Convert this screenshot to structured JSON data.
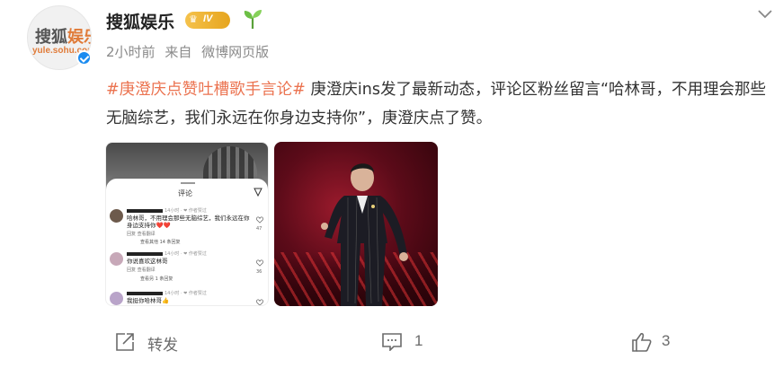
{
  "author": {
    "avatar_logo_cn": "搜狐",
    "avatar_logo_cn_accent": "娱乐",
    "avatar_logo_url": "yule.sohu.com",
    "name": "搜狐娱乐",
    "vip_level": "IV"
  },
  "meta": {
    "time": "2小时前",
    "source_prefix": "来自",
    "source": "微博网页版"
  },
  "post": {
    "hashtag": "#庚澄庆点赞吐槽歌手言论#",
    "text": " 庚澄庆ins发了最新动态，评论区粉丝留言“哈林哥，不用理会那些无脑综艺，我们永远在你身边支持你”，庚澄庆点了赞。"
  },
  "screenshot_thumb": {
    "sheet_title": "评论",
    "comments": [
      {
        "info": "14小时 · ❤ 作者赞过",
        "body": "哈林哥，不用理会那些无脑综艺，我们永远在你身边支持你❤️❤️",
        "actions": "回复    查看翻译",
        "sub": "查看其他 14 条回复",
        "likes": "47"
      },
      {
        "info": "14小时 · ❤ 作者赞过",
        "body": "你说喜欢这林哥",
        "actions": "回复    查看翻译",
        "sub": "查看另 1 条回复",
        "likes": "36"
      },
      {
        "info": "14小时 · ❤ 作者赞过",
        "body": "我挺你哈林哥👍",
        "actions": "",
        "sub": "",
        "likes": ""
      }
    ]
  },
  "actions": {
    "repost_label": "转发",
    "comment_count": "1",
    "like_count": "3"
  },
  "colors": {
    "hashtag": "#eb7350",
    "verify": "#1a8bf0",
    "vip": "#f5c24c"
  }
}
